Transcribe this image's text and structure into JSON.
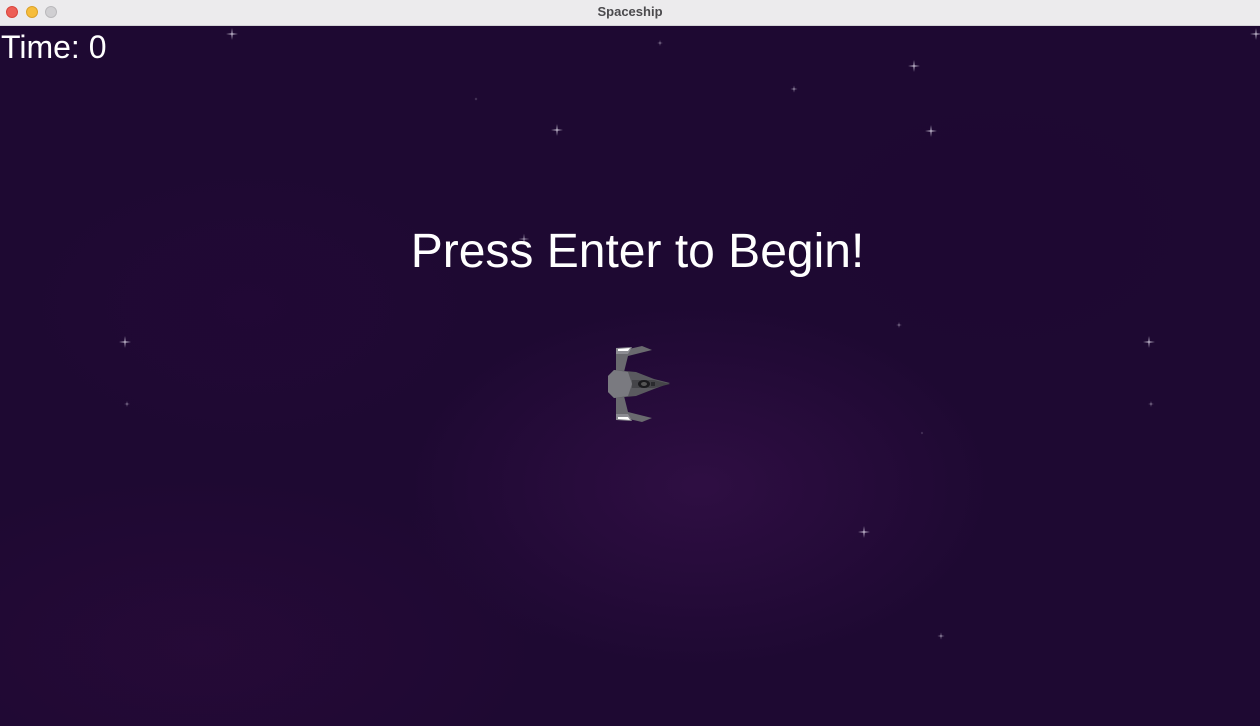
{
  "window": {
    "title": "Spaceship"
  },
  "hud": {
    "time_label": "Time: 0"
  },
  "prompt": {
    "text": "Press Enter to Begin!"
  },
  "colors": {
    "background": "#1e0932",
    "text": "#ffffff",
    "star": "#e8e4f2"
  },
  "icons": {
    "player": "spaceship-icon",
    "stars": "star-icon"
  }
}
